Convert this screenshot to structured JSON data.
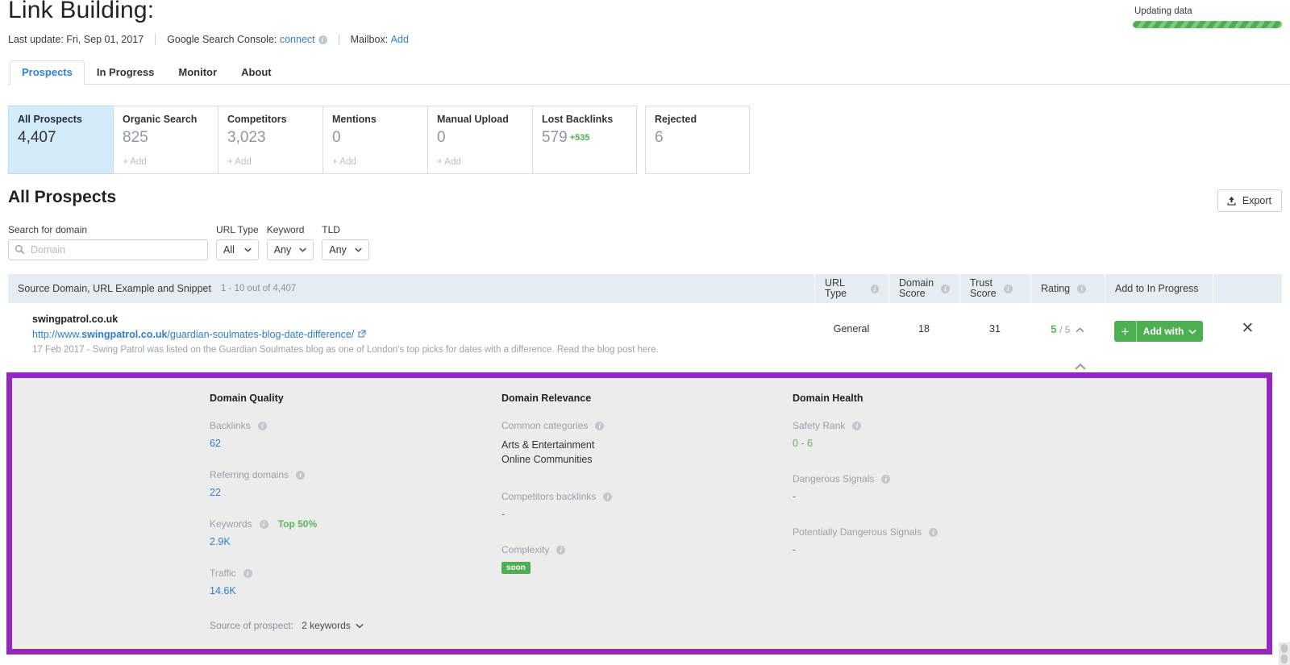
{
  "header": {
    "title": "Link Building:",
    "last_update_label": "Last update: Fri, Sep 01, 2017",
    "gsc_label": "Google Search Console:",
    "gsc_link": "connect",
    "mailbox_label": "Mailbox:",
    "mailbox_link": "Add",
    "updating_label": "Updating data"
  },
  "tabs": [
    {
      "label": "Prospects",
      "active": true
    },
    {
      "label": "In Progress",
      "active": false
    },
    {
      "label": "Monitor",
      "active": false
    },
    {
      "label": "About",
      "active": false
    }
  ],
  "cards": [
    {
      "title": "All Prospects",
      "value": "4,407",
      "add": "",
      "delta": "",
      "active": true
    },
    {
      "title": "Organic Search",
      "value": "825",
      "add": "+ Add",
      "delta": "",
      "active": false
    },
    {
      "title": "Competitors",
      "value": "3,023",
      "add": "+ Add",
      "delta": "",
      "active": false
    },
    {
      "title": "Mentions",
      "value": "0",
      "add": "+ Add",
      "delta": "",
      "active": false
    },
    {
      "title": "Manual Upload",
      "value": "0",
      "add": "+ Add",
      "delta": "",
      "active": false
    },
    {
      "title": "Lost Backlinks",
      "value": "579",
      "add": "",
      "delta": "+535",
      "active": false
    },
    {
      "title": "Rejected",
      "value": "6",
      "add": "",
      "delta": "",
      "active": false
    }
  ],
  "section": {
    "title": "All Prospects",
    "export_label": "Export"
  },
  "filters": {
    "search_label": "Search for domain",
    "search_placeholder": "Domain",
    "search_value": "",
    "url_type_label": "URL Type",
    "url_type_value": "All",
    "keyword_label": "Keyword",
    "keyword_value": "Any",
    "tld_label": "TLD",
    "tld_value": "Any"
  },
  "table": {
    "headers": {
      "source": "Source Domain, URL Example and Snippet",
      "count": "1 - 10 out of 4,407",
      "url_type": "URL Type",
      "domain_score": "Domain Score",
      "domain_score_l1": "Domain",
      "domain_score_l2": "Score",
      "trust_score_l1": "Trust",
      "trust_score_l2": "Score",
      "rating": "Rating",
      "add_to_in_progress": "Add to In Progress"
    },
    "row": {
      "domain": "swingpatrol.co.uk",
      "url_prefix": "http://www.",
      "url_bold": "swingpatrol.co.uk",
      "url_path": "/guardian-soulmates-blog-date-difference/",
      "snippet": "17 Feb 2017 - Swing Patrol was listed on the Guardian Soulmates blog as one of London's top picks for dates with a difference. Read the blog post here.",
      "url_type": "General",
      "domain_score": "18",
      "trust_score": "31",
      "rating_value": "5",
      "rating_max": "/ 5",
      "add_with_label": "Add with",
      "plus_label": "+"
    }
  },
  "detail": {
    "quality": {
      "title": "Domain Quality",
      "backlinks_label": "Backlinks",
      "backlinks_value": "62",
      "referring_label": "Referring domains",
      "referring_value": "22",
      "keywords_label": "Keywords",
      "keywords_badge": "Top 50%",
      "keywords_value": "2.9K",
      "traffic_label": "Traffic",
      "traffic_value": "14.6K"
    },
    "relevance": {
      "title": "Domain Relevance",
      "categories_label": "Common categories",
      "category_1": "Arts & Entertainment",
      "category_2": "Online Communities",
      "competitors_label": "Competitors backlinks",
      "competitors_value": "-",
      "complexity_label": "Complexity",
      "complexity_badge": "soon"
    },
    "health": {
      "title": "Domain Health",
      "safety_label": "Safety Rank",
      "safety_value": "0 - 6",
      "dangerous_label": "Dangerous Signals",
      "dangerous_value": "-",
      "potentially_label": "Potentially Dangerous Signals",
      "potentially_value": "-"
    },
    "source_label": "Source of prospect:",
    "source_value": "2 keywords"
  },
  "colors": {
    "accent_blue": "#2f7fd1",
    "green": "#4caf50",
    "highlight_purple": "#9427bd",
    "card_active_bg": "#d4ebf9",
    "thead_bg": "#e6edf2",
    "panel_bg": "#ececec"
  }
}
